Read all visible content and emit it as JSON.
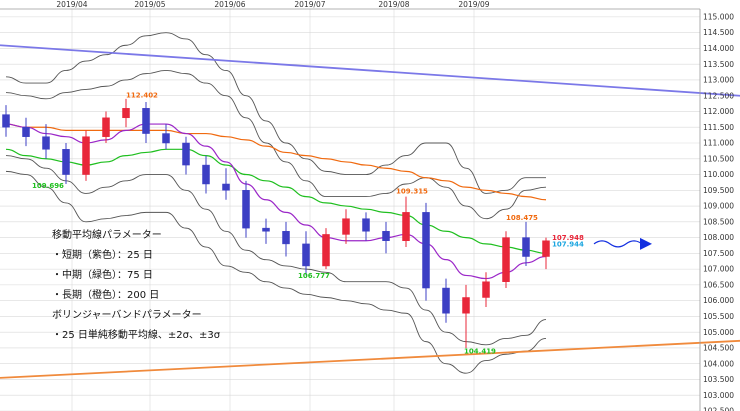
{
  "chart_data": {
    "type": "candlestick",
    "title": "",
    "xlabel": "",
    "ylabel": "",
    "ylim": [
      102.5,
      115.25
    ],
    "y_ticks": [
      102.5,
      103.0,
      103.5,
      104.0,
      104.5,
      105.0,
      105.5,
      106.0,
      106.5,
      107.0,
      107.5,
      108.0,
      108.5,
      109.0,
      109.5,
      110.0,
      110.5,
      111.0,
      111.5,
      112.0,
      112.5,
      113.0,
      113.5,
      114.0,
      114.5,
      115.0
    ],
    "month_ticks": [
      {
        "label": "2019/04",
        "week": 3.3
      },
      {
        "label": "2019/05",
        "week": 7.2
      },
      {
        "label": "2019/06",
        "week": 11.2
      },
      {
        "label": "2019/07",
        "week": 15.2
      },
      {
        "label": "2019/08",
        "week": 19.4
      },
      {
        "label": "2019/09",
        "week": 23.4
      }
    ],
    "grid": true,
    "colors": {
      "up": "#e8273a",
      "down": "#3c3fc4",
      "sma_short": "#9b27c8",
      "sma_mid": "#1fbf1f",
      "sma_long": "#f06a10",
      "bollinger": "#555555",
      "trend_upper": "#7b78e8",
      "trend_lower": "#f08a3c",
      "forecast_arrow": "#1430e0",
      "last_price_up": "#e8273a",
      "last_price_mid": "#1aa6e0"
    },
    "weekly_ohlc": [
      {
        "o": 111.9,
        "h": 112.2,
        "l": 111.2,
        "c": 111.5
      },
      {
        "o": 111.5,
        "h": 111.8,
        "l": 110.9,
        "c": 111.2
      },
      {
        "o": 111.2,
        "h": 111.6,
        "l": 110.5,
        "c": 110.8
      },
      {
        "o": 110.8,
        "h": 111.0,
        "l": 109.7,
        "c": 110.0
      },
      {
        "o": 110.0,
        "h": 111.4,
        "l": 109.8,
        "c": 111.2
      },
      {
        "o": 111.2,
        "h": 112.0,
        "l": 111.0,
        "c": 111.8
      },
      {
        "o": 111.8,
        "h": 112.4,
        "l": 111.5,
        "c": 112.1
      },
      {
        "o": 112.1,
        "h": 112.3,
        "l": 111.0,
        "c": 111.3
      },
      {
        "o": 111.3,
        "h": 111.6,
        "l": 110.8,
        "c": 111.0
      },
      {
        "o": 111.0,
        "h": 111.2,
        "l": 110.0,
        "c": 110.3
      },
      {
        "o": 110.3,
        "h": 110.6,
        "l": 109.4,
        "c": 109.7
      },
      {
        "o": 109.7,
        "h": 110.2,
        "l": 109.2,
        "c": 109.5
      },
      {
        "o": 109.5,
        "h": 109.8,
        "l": 108.0,
        "c": 108.3
      },
      {
        "o": 108.3,
        "h": 108.6,
        "l": 107.8,
        "c": 108.2
      },
      {
        "o": 108.2,
        "h": 108.5,
        "l": 107.4,
        "c": 107.8
      },
      {
        "o": 107.8,
        "h": 108.2,
        "l": 106.8,
        "c": 107.1
      },
      {
        "o": 107.1,
        "h": 108.3,
        "l": 107.0,
        "c": 108.1
      },
      {
        "o": 108.1,
        "h": 108.9,
        "l": 107.8,
        "c": 108.6
      },
      {
        "o": 108.6,
        "h": 108.8,
        "l": 107.9,
        "c": 108.2
      },
      {
        "o": 108.2,
        "h": 108.5,
        "l": 107.5,
        "c": 107.9
      },
      {
        "o": 107.9,
        "h": 109.3,
        "l": 107.7,
        "c": 108.8
      },
      {
        "o": 108.8,
        "h": 109.1,
        "l": 106.0,
        "c": 106.4
      },
      {
        "o": 106.4,
        "h": 106.7,
        "l": 105.3,
        "c": 105.6
      },
      {
        "o": 105.6,
        "h": 106.5,
        "l": 104.5,
        "c": 106.1
      },
      {
        "o": 106.1,
        "h": 106.9,
        "l": 105.8,
        "c": 106.6
      },
      {
        "o": 106.6,
        "h": 108.2,
        "l": 106.4,
        "c": 108.0
      },
      {
        "o": 108.0,
        "h": 108.5,
        "l": 107.1,
        "c": 107.4
      },
      {
        "o": 107.4,
        "h": 108.0,
        "l": 107.0,
        "c": 107.9
      }
    ],
    "series": [
      {
        "name": "短期（紫色）：25 日",
        "key": "sma_short",
        "values": [
          111.6,
          111.5,
          111.3,
          111.2,
          111.0,
          111.1,
          111.4,
          111.6,
          111.6,
          111.3,
          110.9,
          110.4,
          109.7,
          109.2,
          108.8,
          108.4,
          108.0,
          107.9,
          107.9,
          108.0,
          108.1,
          107.8,
          107.3,
          106.8,
          106.7,
          106.9,
          107.2,
          107.4
        ]
      },
      {
        "name": "中期（緑色）：75 日",
        "key": "sma_mid",
        "values": [
          110.8,
          110.6,
          110.5,
          110.4,
          110.3,
          110.4,
          110.6,
          110.7,
          110.8,
          110.8,
          110.6,
          110.3,
          110.0,
          109.8,
          109.6,
          109.3,
          109.1,
          109.0,
          108.9,
          108.8,
          108.7,
          108.4,
          108.2,
          108.0,
          107.8,
          107.7,
          107.6,
          107.5
        ]
      },
      {
        "name": "長期（橙色）：200 日",
        "key": "sma_long",
        "values": [
          111.6,
          111.5,
          111.5,
          111.4,
          111.4,
          111.4,
          111.4,
          111.4,
          111.4,
          111.3,
          111.3,
          111.2,
          111.1,
          110.9,
          110.7,
          110.6,
          110.5,
          110.4,
          110.3,
          110.2,
          110.1,
          109.9,
          109.8,
          109.6,
          109.5,
          109.4,
          109.3,
          109.2
        ]
      },
      {
        "name": "BB+2σ",
        "key": "bb_up2",
        "values": [
          112.6,
          112.5,
          112.4,
          112.6,
          112.7,
          112.8,
          113.0,
          113.2,
          113.3,
          113.2,
          112.9,
          112.5,
          111.8,
          111.0,
          110.4,
          109.8,
          109.3,
          109.3,
          109.3,
          109.4,
          109.7,
          109.9,
          109.6,
          109.0,
          108.6,
          108.9,
          109.5,
          109.6
        ]
      },
      {
        "name": "BB+3σ",
        "key": "bb_up3",
        "values": [
          113.1,
          112.9,
          112.9,
          113.3,
          113.6,
          113.8,
          114.1,
          114.4,
          114.5,
          114.3,
          113.8,
          113.3,
          112.5,
          111.7,
          111.0,
          110.5,
          110.1,
          110.0,
          110.0,
          110.3,
          110.6,
          111.0,
          111.0,
          110.2,
          109.4,
          109.5,
          109.9,
          109.9
        ]
      },
      {
        "name": "BB-2σ",
        "key": "bb_dn2",
        "values": [
          110.6,
          110.5,
          110.2,
          109.8,
          109.4,
          109.6,
          109.8,
          110.0,
          110.0,
          109.5,
          108.9,
          108.2,
          107.6,
          107.3,
          107.1,
          107.0,
          106.9,
          106.6,
          106.6,
          106.6,
          106.4,
          105.7,
          105.0,
          104.7,
          104.6,
          104.8,
          104.9,
          105.4
        ]
      },
      {
        "name": "BB-3σ",
        "key": "bb_dn3",
        "values": [
          110.1,
          110.0,
          109.6,
          109.1,
          108.5,
          108.6,
          108.7,
          108.8,
          108.8,
          108.3,
          107.7,
          107.1,
          106.9,
          106.6,
          106.4,
          106.2,
          106.1,
          106.0,
          105.9,
          105.7,
          105.6,
          104.7,
          104.0,
          103.7,
          104.1,
          104.3,
          104.4,
          104.8
        ]
      }
    ],
    "trendlines": [
      {
        "name": "upper-trendline",
        "key": "trend_upper",
        "x": [
          0,
          39
        ],
        "y": [
          114.1,
          112.4
        ]
      },
      {
        "name": "lower-trendline",
        "key": "trend_lower",
        "x": [
          0,
          39
        ],
        "y": [
          103.55,
          104.8
        ]
      }
    ],
    "annotations": [
      {
        "text": "112.402",
        "week": 6.8,
        "price": 112.45,
        "color": "#f06a10"
      },
      {
        "text": "109.696",
        "week": 2.1,
        "price": 109.58,
        "color": "#1fbf1f"
      },
      {
        "text": "109.315",
        "week": 20.3,
        "price": 109.4,
        "color": "#f06a10"
      },
      {
        "text": "108.475",
        "week": 25.8,
        "price": 108.55,
        "color": "#f06a10"
      },
      {
        "text": "106.777",
        "week": 15.4,
        "price": 106.72,
        "color": "#1fbf1f"
      },
      {
        "text": "104.419",
        "week": 23.7,
        "price": 104.33,
        "color": "#1fbf1f"
      }
    ],
    "last_price_labels": [
      {
        "text": "107.948",
        "price": 108.0,
        "color": "#e8273a"
      },
      {
        "text": "107.944",
        "price": 107.8,
        "color": "#1aa6e0"
      }
    ],
    "legend": {
      "placement": "bottom-left",
      "lines": [
        "移動平均線パラメーター",
        "・短期（紫色）：25 日",
        "・中期（緑色）：75 日",
        "・長期（橙色）：200 日",
        "ボリンジャーバンドパラメーター",
        "・25 日単純移動平均線、±2σ、±3σ"
      ]
    }
  }
}
